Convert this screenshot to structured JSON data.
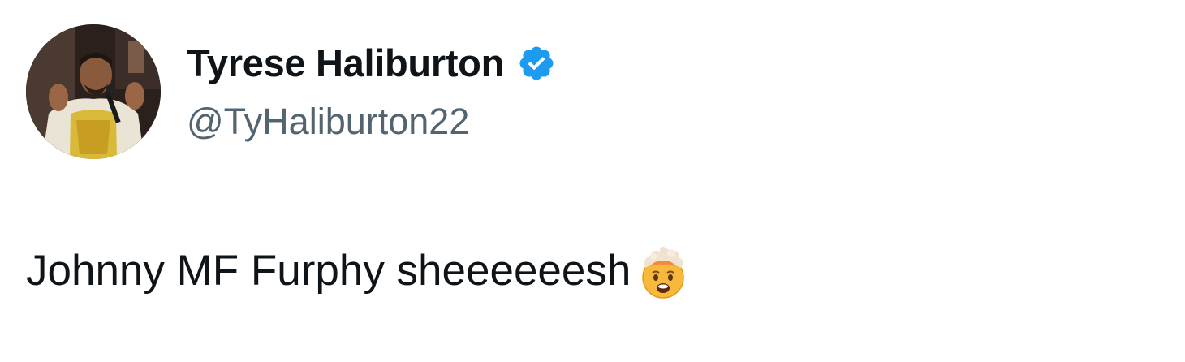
{
  "author": {
    "display_name": "Tyrese Haliburton",
    "handle": "@TyHaliburton22",
    "verified": true,
    "verified_color": "#1d9bf0"
  },
  "tweet": {
    "text": "Johnny MF Furphy sheeeeeesh",
    "emoji": "exploding-head-emoji"
  },
  "colors": {
    "text_primary": "#0f1419",
    "text_secondary": "#536471",
    "background": "#ffffff"
  }
}
